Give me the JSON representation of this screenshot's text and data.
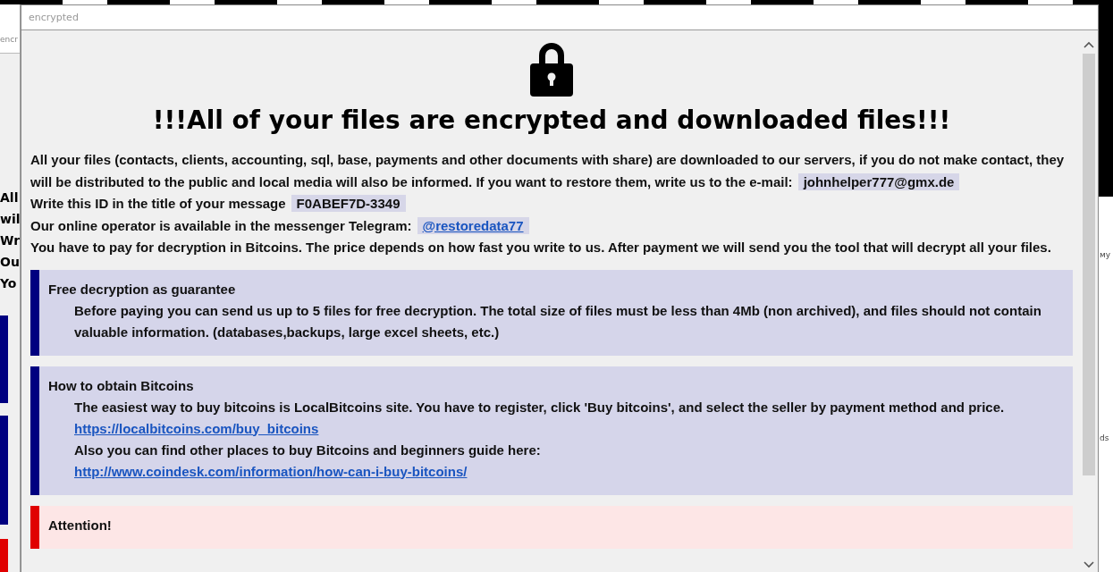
{
  "back_window": {
    "title_fragment": "encr",
    "line_fragments": [
      "All",
      "wil",
      "Wr",
      "Ou",
      "Yo"
    ],
    "right_fragments": [
      "му",
      "ds"
    ]
  },
  "window": {
    "title": "encrypted"
  },
  "note": {
    "heading": "!!!All of your files are encrypted and downloaded files!!!",
    "paragraphs": [
      {
        "text": "All your files (contacts, clients, accounting, sql, base, payments and other documents with share) are downloaded to our servers, if you do not make contact, they will be distributed to the public and local media will also be informed. If you want to restore them, write us to the e-mail:",
        "chip": {
          "text": "johnhelper777@gmx.de",
          "link": false
        }
      },
      {
        "text": "Write this ID in the title of your message",
        "chip": {
          "text": "F0ABEF7D-3349",
          "link": false
        }
      },
      {
        "text": "Our online operator is available in the messenger Telegram:",
        "chip": {
          "text": "@restoredata77",
          "link": true
        }
      },
      {
        "text": "You have to pay for decryption in Bitcoins. The price depends on how fast you write to us. After payment we will send you the tool that will decrypt all your files."
      }
    ],
    "sections": [
      {
        "kind": "info",
        "title": "Free decryption as guarantee",
        "lines": [
          {
            "kind": "text",
            "text": "Before paying you can send us up to 5 files for free decryption. The total size of files must be less than 4Mb (non archived), and files should not contain valuable information. (databases,backups, large excel sheets, etc.)"
          }
        ]
      },
      {
        "kind": "info",
        "title": "How to obtain Bitcoins",
        "lines": [
          {
            "kind": "text",
            "text": "The easiest way to buy bitcoins is LocalBitcoins site. You have to register, click 'Buy bitcoins', and select the seller by payment method and price."
          },
          {
            "kind": "link",
            "text": "https://localbitcoins.com/buy_bitcoins"
          },
          {
            "kind": "text",
            "text": "Also you can find other places to buy Bitcoins and beginners guide here:"
          },
          {
            "kind": "link",
            "text": "http://www.coindesk.com/information/how-can-i-buy-bitcoins/"
          }
        ]
      },
      {
        "kind": "warning",
        "title": "Attention!"
      }
    ]
  }
}
